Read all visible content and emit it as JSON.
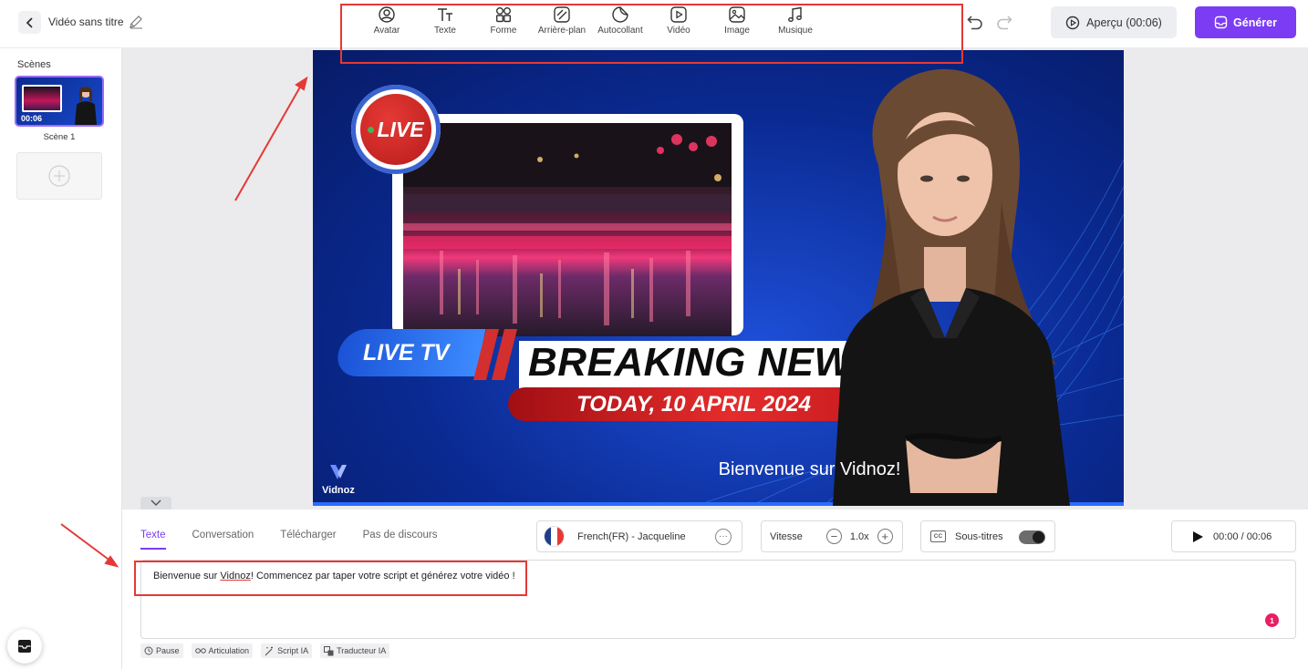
{
  "header": {
    "title": "Vidéo sans titre",
    "tools": [
      {
        "label": "Avatar",
        "icon": "avatar-icon"
      },
      {
        "label": "Texte",
        "icon": "text-icon"
      },
      {
        "label": "Forme",
        "icon": "shape-icon"
      },
      {
        "label": "Arrière-plan",
        "icon": "background-icon"
      },
      {
        "label": "Autocollant",
        "icon": "sticker-icon"
      },
      {
        "label": "Vidéo",
        "icon": "video-icon"
      },
      {
        "label": "Image",
        "icon": "image-icon"
      },
      {
        "label": "Musique",
        "icon": "music-icon"
      }
    ],
    "preview_label": "Aperçu (00:06)",
    "generate_label": "Générer"
  },
  "scenes": {
    "label": "Scènes",
    "items": [
      {
        "name": "Scène 1",
        "duration": "00:06"
      }
    ]
  },
  "canvas": {
    "live_badge": "LIVE",
    "live_tv": "LIVE TV",
    "headline": "BREAKING NEWS",
    "date": "TODAY, 10 APRIL 2024",
    "caption": "Bienvenue sur Vidnoz!",
    "brand": "Vidnoz"
  },
  "editor": {
    "tabs": [
      "Texte",
      "Conversation",
      "Télécharger",
      "Pas de discours"
    ],
    "active_tab": "Texte",
    "voice": "French(FR) - Jacqueline",
    "speed_label": "Vitesse",
    "speed_value": "1.0x",
    "subtitles_label": "Sous-titres",
    "subtitles_on": true,
    "playback_time": "00:00 / 00:06",
    "script_before": "Bienvenue sur ",
    "script_word": "Vidnoz",
    "script_after": "! Commencez par taper votre script et générez votre vidéo !",
    "issue_count": "1",
    "chips": [
      "Pause",
      "Articulation",
      "Script IA",
      "Traducteur IA"
    ]
  },
  "colors": {
    "accent": "#7b3cf4",
    "annotation": "#e53935"
  }
}
